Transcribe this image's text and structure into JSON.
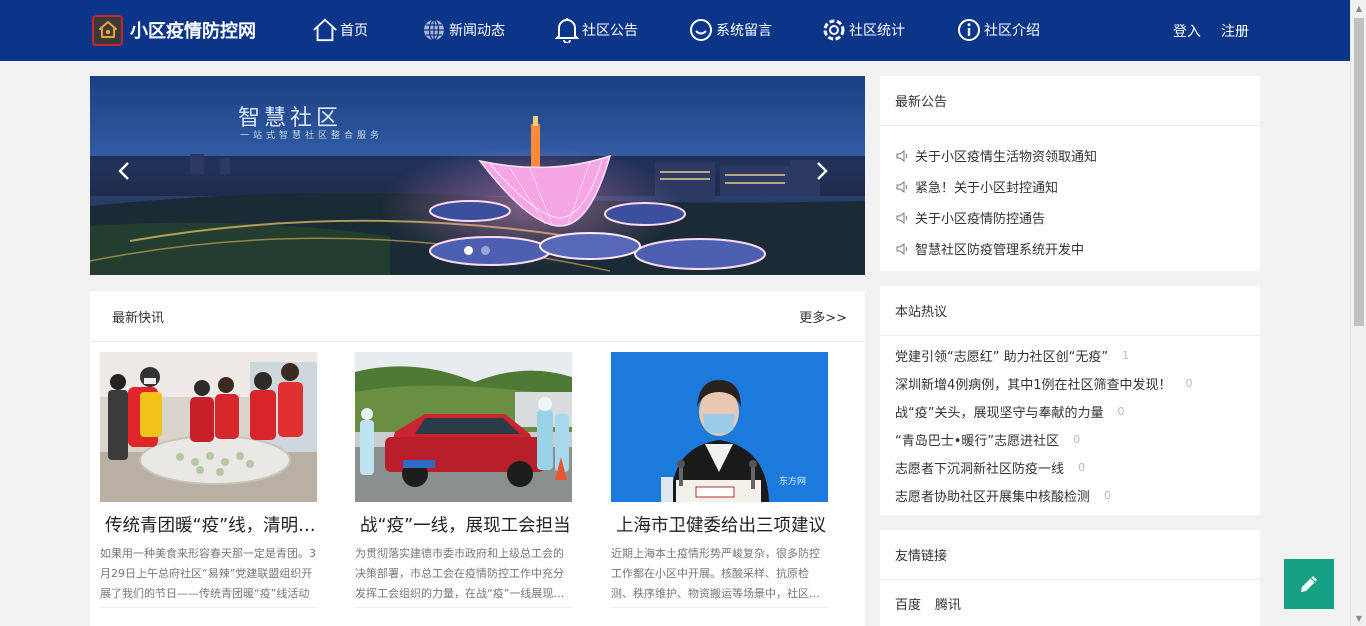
{
  "header": {
    "site_title": "小区疫情防控网",
    "nav": [
      {
        "label": "首页",
        "icon": "home-icon"
      },
      {
        "label": "新闻动态",
        "icon": "globe-icon"
      },
      {
        "label": "社区公告",
        "icon": "bell-icon"
      },
      {
        "label": "系统留言",
        "icon": "smile-icon"
      },
      {
        "label": "社区统计",
        "icon": "settings-icon"
      },
      {
        "label": "社区介绍",
        "icon": "info-icon"
      }
    ],
    "login": "登入",
    "register": "注册"
  },
  "banner": {
    "title": "智慧社区",
    "subtitle": "一站式智慧社区整合服务",
    "active_slide": 1,
    "slide_count": 2
  },
  "news": {
    "heading": "最新快讯",
    "more": "更多>>",
    "cards": [
      {
        "title": "传统青团暖“疫”线，清明情深寄哀思",
        "text": "如果用一种美食来形容春天那一定是青团。3月29日上午总府社区“易辣”党建联盟组织开展了我们的节日——传统青团暖“疫”线活动"
      },
      {
        "title": "战“疫”一线，展现工会担当",
        "text": "为贯彻落实建德市委市政府和上级总工会的决策部署，市总工会在疫情防控工作中充分发挥工会组织的力量，在战“疫”一线展现工会担当"
      },
      {
        "title": "上海市卫健委给出三项建议",
        "text": "近期上海本土疫情形势严峻复杂，很多防控工作都在小区中开展。核酸采样、抗原检测、秩序维护、物资搬运等场景中，社区工作者和志愿者"
      }
    ]
  },
  "notice": {
    "heading": "最新公告",
    "items": [
      "关于小区疫情生活物资领取通知",
      "紧急！关于小区封控通知",
      "关于小区疫情防控通告",
      "智慧社区防疫管理系统开发中"
    ]
  },
  "hot": {
    "heading": "本站热议",
    "items": [
      {
        "title": "党建引领“志愿红” 助力社区创“无疫”",
        "count": "1"
      },
      {
        "title": "深圳新增4例病例，其中1例在社区筛查中发现！",
        "count": "0"
      },
      {
        "title": "战“疫”关头，展现坚守与奉献的力量",
        "count": "0"
      },
      {
        "title": "“青岛巴士•暖行”志愿进社区",
        "count": "0"
      },
      {
        "title": "志愿者下沉洞新社区防疫一线",
        "count": "0"
      },
      {
        "title": "志愿者协助社区开展集中核酸检测",
        "count": "0"
      }
    ]
  },
  "links": {
    "heading": "友情链接",
    "items": [
      "百度",
      "腾讯"
    ]
  },
  "colors": {
    "header_bg": "#0b3589",
    "fab_bg": "#16a085"
  }
}
